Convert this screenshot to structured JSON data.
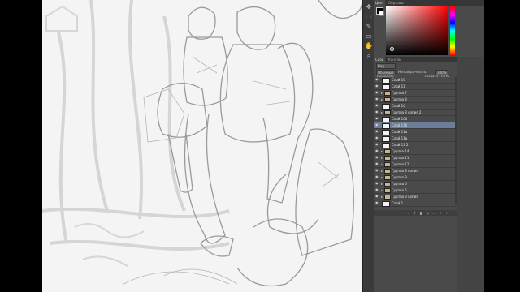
{
  "app": {
    "name": "Photoshop",
    "accent": "#6c7d99",
    "panel_bg": "#4a4a4a"
  },
  "tools": [
    "move-tool",
    "marquee-tool",
    "brush-tool",
    "eraser-tool",
    "hand-tool",
    "zoom-tool"
  ],
  "color_panel": {
    "tabs": [
      {
        "label": "Цвет"
      },
      {
        "label": "Образцы"
      }
    ],
    "foreground": "#000000",
    "background": "#ffffff",
    "hue": "#ff0000"
  },
  "layers_panel": {
    "tabs": [
      {
        "label": "Слои"
      },
      {
        "label": "Каналы"
      }
    ],
    "kind_filter": "Вид",
    "blend_mode": "Обычные",
    "opacity_label": "Непрозрачность:",
    "opacity_value": "100%",
    "lock_label": "Закрепить:",
    "fill_label": "Заливка:",
    "fill_value": "100%",
    "layers": [
      {
        "name": "Слой 16",
        "kind": "layer",
        "visible": true,
        "selected": false
      },
      {
        "name": "Слой 11",
        "kind": "layer",
        "visible": true,
        "selected": false
      },
      {
        "name": "Группа 7",
        "kind": "group",
        "visible": true,
        "selected": false
      },
      {
        "name": "Группа 8",
        "kind": "group",
        "visible": true,
        "selected": false
      },
      {
        "name": "Слой 10",
        "kind": "layer",
        "visible": true,
        "selected": false
      },
      {
        "name": "Группа 8 копия 2",
        "kind": "group",
        "visible": true,
        "selected": false
      },
      {
        "name": "Слой 10б",
        "kind": "layer",
        "visible": true,
        "selected": false
      },
      {
        "name": "Слой 11б",
        "kind": "layer",
        "visible": true,
        "selected": true
      },
      {
        "name": "Слой 11а",
        "kind": "layer",
        "visible": true,
        "selected": false
      },
      {
        "name": "Слой 11в",
        "kind": "layer",
        "visible": true,
        "selected": false
      },
      {
        "name": "Слой 11 2",
        "kind": "layer",
        "visible": true,
        "selected": false
      },
      {
        "name": "Группа 14",
        "kind": "group",
        "visible": true,
        "selected": false
      },
      {
        "name": "Группа 11",
        "kind": "group",
        "visible": true,
        "selected": false
      },
      {
        "name": "Группа 12",
        "kind": "group",
        "visible": true,
        "selected": false
      },
      {
        "name": "Группа 8 копия",
        "kind": "group",
        "visible": true,
        "selected": false
      },
      {
        "name": "Группа 9",
        "kind": "group",
        "visible": true,
        "selected": false
      },
      {
        "name": "Группа 6",
        "kind": "group",
        "visible": true,
        "selected": false
      },
      {
        "name": "Группа 5",
        "kind": "group",
        "visible": true,
        "selected": false
      },
      {
        "name": "Группа 8 копия",
        "kind": "group",
        "visible": true,
        "selected": false
      },
      {
        "name": "Слой 1",
        "kind": "layer",
        "visible": true,
        "selected": false
      }
    ],
    "bottom_icons": [
      "link-icon",
      "fx-icon",
      "mask-icon",
      "adjustment-icon",
      "folder-icon",
      "new-layer-icon",
      "trash-icon"
    ]
  }
}
